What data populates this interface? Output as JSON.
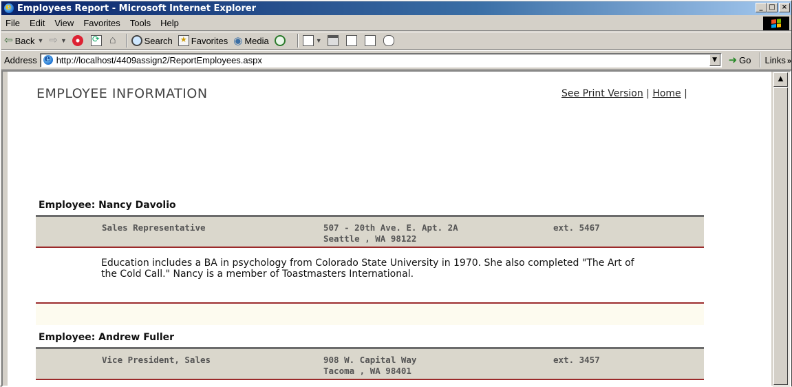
{
  "window": {
    "title": "Employees Report - Microsoft Internet Explorer",
    "buttons": {
      "minimize": "_",
      "maximize": "□",
      "close": "×"
    }
  },
  "menu": [
    "File",
    "Edit",
    "View",
    "Favorites",
    "Tools",
    "Help"
  ],
  "toolbar": {
    "back": "Back",
    "search": "Search",
    "favorites": "Favorites",
    "media": "Media"
  },
  "address": {
    "label": "Address",
    "url": "http://localhost/4409assign2/ReportEmployees.aspx",
    "go": "Go",
    "links": "Links"
  },
  "page": {
    "title": "EMPLOYEE INFORMATION",
    "print_link": "See Print Version",
    "home_link": "Home",
    "sep1": "|",
    "sep2": "|"
  },
  "employees": [
    {
      "heading": "Employee: Nancy Davolio",
      "title": "Sales Representative",
      "address1": "507 - 20th Ave. E. Apt. 2A",
      "address2": "Seattle , WA  98122",
      "ext": "ext. 5467",
      "notes": "Education includes a BA in psychology from Colorado State University in 1970. She also completed \"The Art of the Cold Call.\" Nancy is a member of Toastmasters International."
    },
    {
      "heading": "Employee: Andrew Fuller",
      "title": "Vice President, Sales",
      "address1": "908 W. Capital Way",
      "address2": "Tacoma , WA  98401",
      "ext": "ext. 3457"
    }
  ]
}
